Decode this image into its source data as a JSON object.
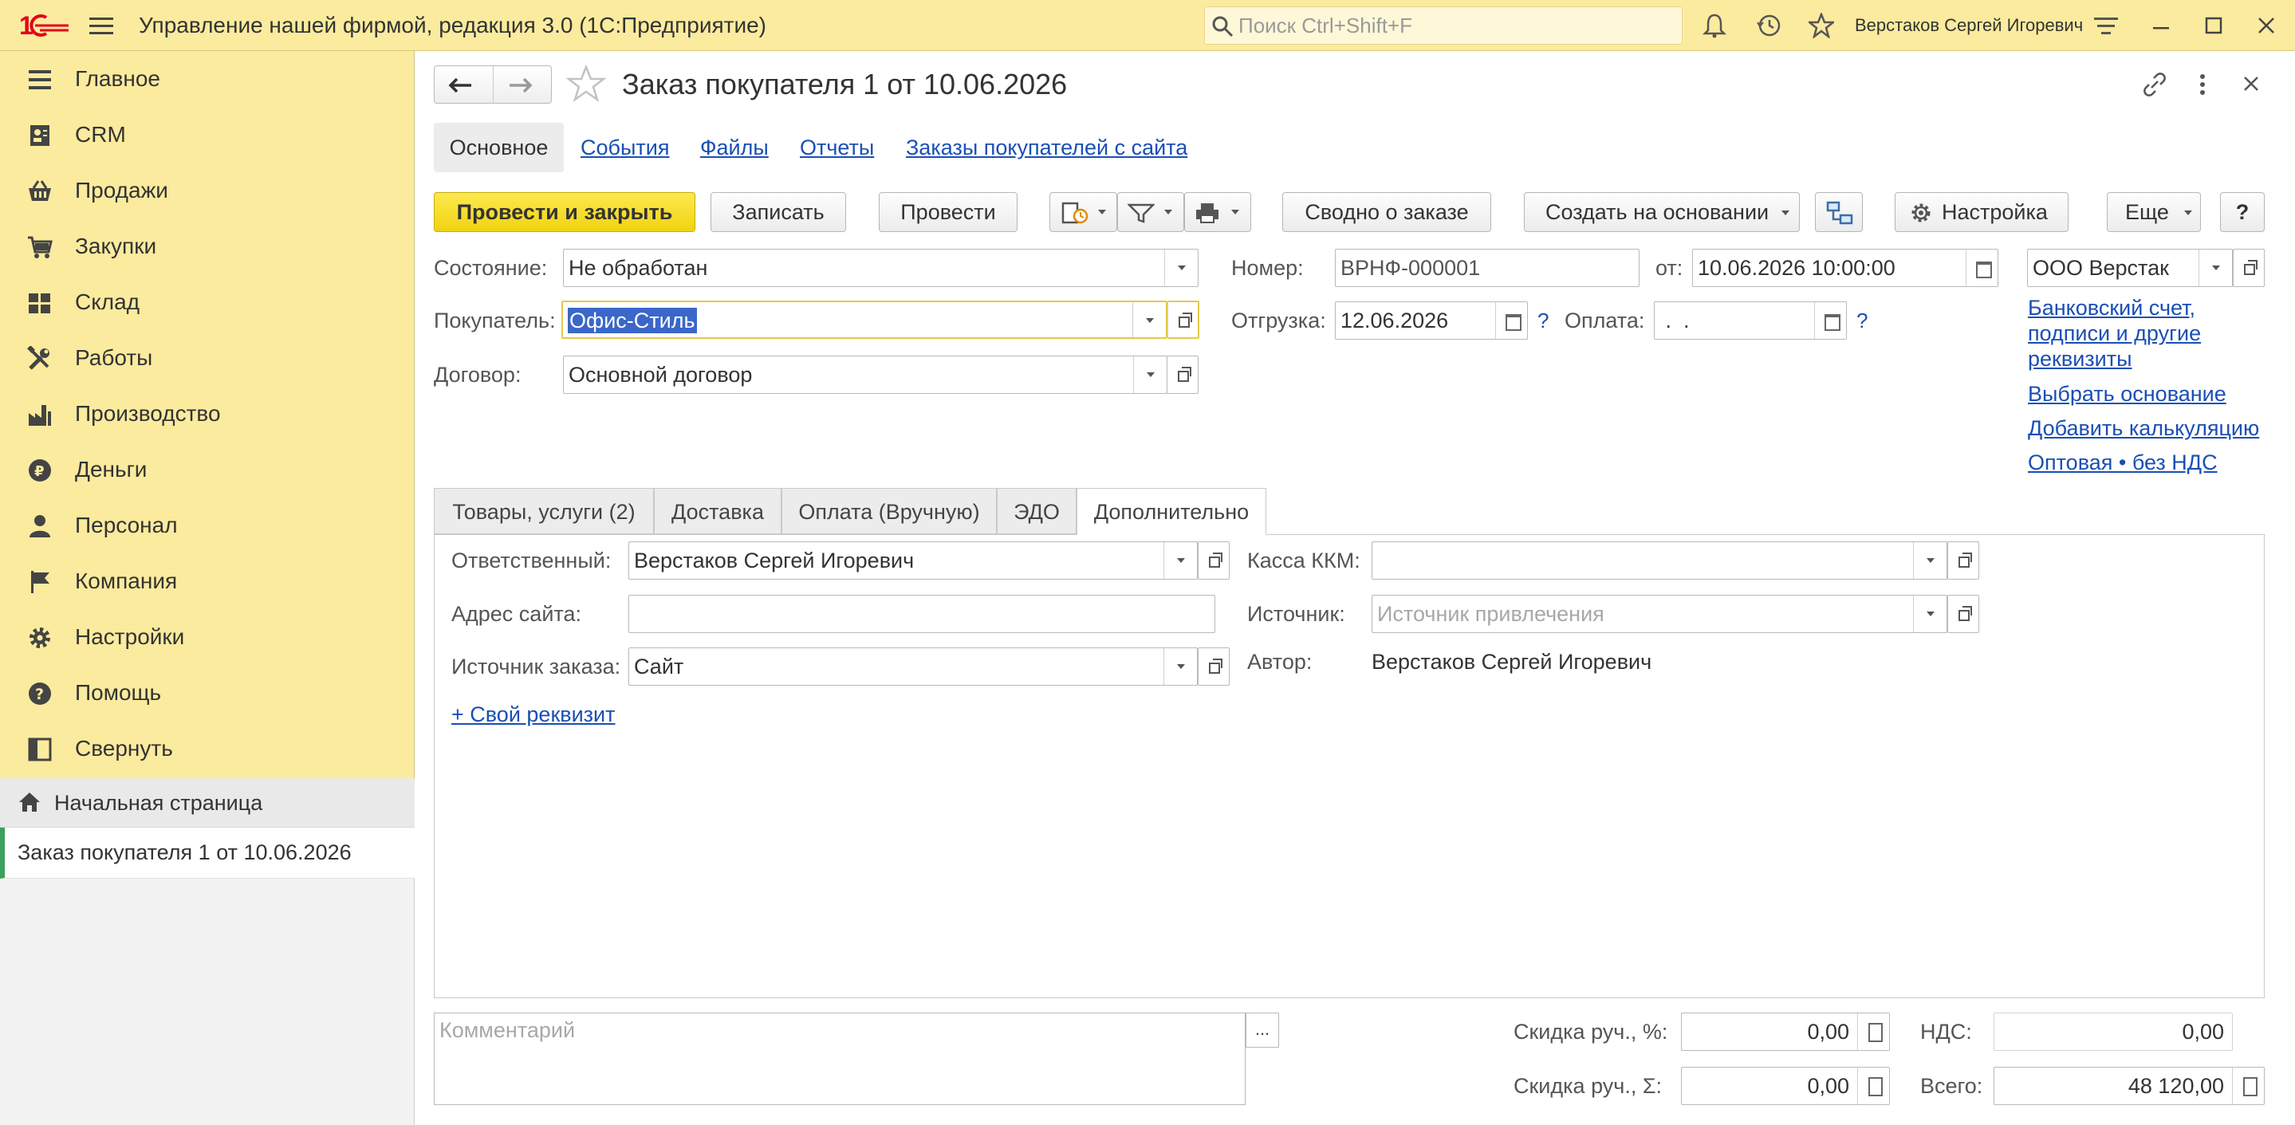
{
  "app": {
    "title": "Управление нашей фирмой, редакция 3.0  (1С:Предприятие)",
    "search_placeholder": "Поиск Ctrl+Shift+F",
    "user": "Верстаков Сергей Игоревич",
    "brand_color": "#e2001a",
    "accent_yellow": "#fbeb9e"
  },
  "sidebar": {
    "items": [
      {
        "label": "Главное",
        "icon": "hamburger-list-icon"
      },
      {
        "label": "CRM",
        "icon": "contact-card-icon"
      },
      {
        "label": "Продажи",
        "icon": "basket-icon"
      },
      {
        "label": "Закупки",
        "icon": "cart-icon"
      },
      {
        "label": "Склад",
        "icon": "warehouse-grid-icon"
      },
      {
        "label": "Работы",
        "icon": "tools-icon"
      },
      {
        "label": "Производство",
        "icon": "factory-icon"
      },
      {
        "label": "Деньги",
        "icon": "ruble-coin-icon"
      },
      {
        "label": "Персонал",
        "icon": "person-icon"
      },
      {
        "label": "Компания",
        "icon": "flag-icon"
      },
      {
        "label": "Настройки",
        "icon": "gear-icon"
      },
      {
        "label": "Помощь",
        "icon": "help-icon"
      },
      {
        "label": "Свернуть",
        "icon": "collapse-panel-icon"
      }
    ],
    "home_label": "Начальная страница",
    "open_doc_label": "Заказ покупателя 1 от 10.06.2026"
  },
  "doc": {
    "title": "Заказ покупателя 1 от 10.06.2026",
    "nav_tabs": [
      "Основное",
      "События",
      "Файлы",
      "Отчеты",
      "Заказы покупателей с сайта"
    ],
    "toolbar": {
      "post_close": "Провести и закрыть",
      "save": "Записать",
      "post": "Провести",
      "summary": "Сводно о заказе",
      "create_based": "Создать на основании",
      "settings": "Настройка",
      "more": "Еще",
      "help": "?"
    },
    "fields": {
      "state_label": "Состояние:",
      "state_value": "Не обработан",
      "buyer_label": "Покупатель:",
      "buyer_value": "Офис-Стиль",
      "contract_label": "Договор:",
      "contract_value": "Основной договор",
      "number_label": "Номер:",
      "number_value": "ВРНФ-000001",
      "date_label": "от:",
      "date_value": "10.06.2026 10:00:00",
      "org_value": "ООО Верстак",
      "shipment_label": "Отгрузка:",
      "shipment_value": "12.06.2026",
      "payment_label": "Оплата:",
      "payment_value": " .  . ",
      "question": "?"
    },
    "side_links": [
      "Банковский счет, подписи и другие реквизиты",
      "Выбрать основание",
      "Добавить калькуляцию",
      "Оптовая • без НДС"
    ],
    "tabs": [
      "Товары, услуги (2)",
      "Доставка",
      "Оплата (Вручную)",
      "ЭДО",
      "Дополнительно"
    ],
    "extra": {
      "responsible_label": "Ответственный:",
      "responsible_value": "Верстаков Сергей Игоревич",
      "site_label": "Адрес сайта:",
      "site_value": "",
      "order_source_label": "Источник заказа:",
      "order_source_value": "Сайт",
      "add_attr": "+ Свой реквизит",
      "kkm_label": "Касса ККМ:",
      "kkm_value": "",
      "source_label": "Источник:",
      "source_placeholder": "Источник привлечения",
      "author_label": "Автор:",
      "author_value": "Верстаков Сергей Игоревич"
    },
    "footer": {
      "comment_placeholder": "Комментарий",
      "ellipsis": "...",
      "discount_pct_label": "Скидка руч., %:",
      "discount_pct_value": "0,00",
      "discount_sum_label": "Скидка руч., Σ:",
      "discount_sum_value": "0,00",
      "vat_label": "НДС:",
      "vat_value": "0,00",
      "total_label": "Всего:",
      "total_value": "48 120,00"
    }
  }
}
